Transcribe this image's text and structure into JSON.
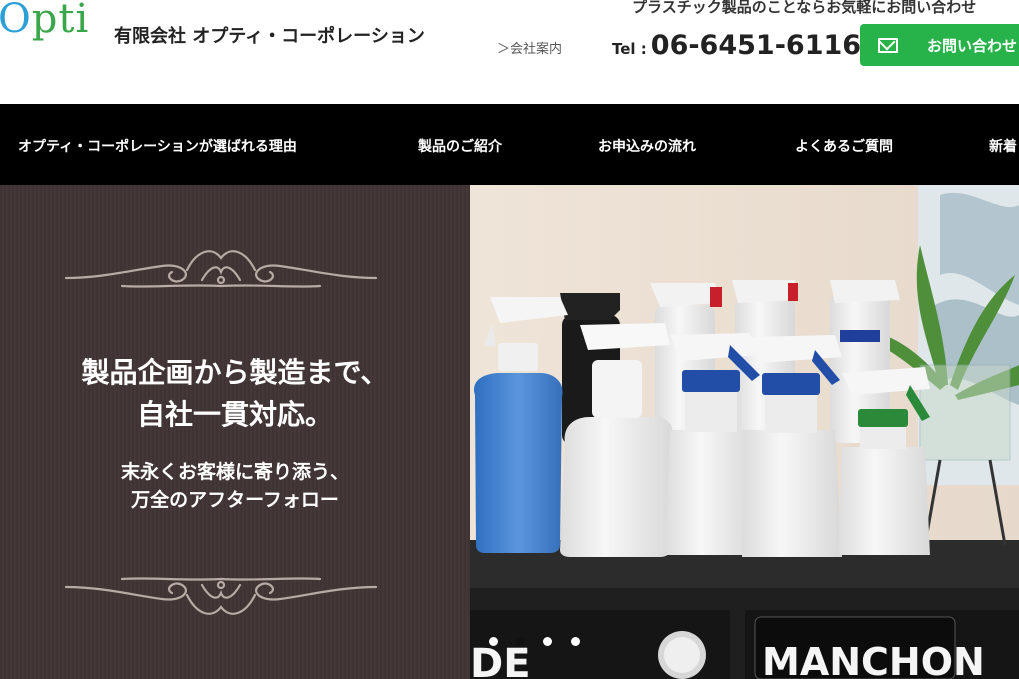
{
  "header": {
    "logo_text_a": "O",
    "logo_text_b": "pti",
    "company_name": "有限会社 オプティ・コーポレーション",
    "company_link": "＞会社案内",
    "tagline": "プラスチック製品のことならお気軽にお問い合わせ",
    "tel_label": "Tel :",
    "tel_number": "06-6451-6116",
    "contact_button": "お問い合わせ"
  },
  "nav": {
    "items": [
      "オプティ・コーポレーションが選ばれる理由",
      "製品のご紹介",
      "お申込みの流れ",
      "よくあるご質問",
      "新着"
    ]
  },
  "hero": {
    "headline_1": "製品企画から製造まで、",
    "headline_2": "自社一貫対応。",
    "subline_1": "末永くお客様に寄り添う、",
    "subline_2": "万全のアフターフォロー",
    "sign_left": "DE",
    "sign_right": "MANCHON"
  },
  "colors": {
    "accent_green": "#27b34a",
    "nav_bg": "#000000",
    "panel_bg": "#3f3433"
  }
}
